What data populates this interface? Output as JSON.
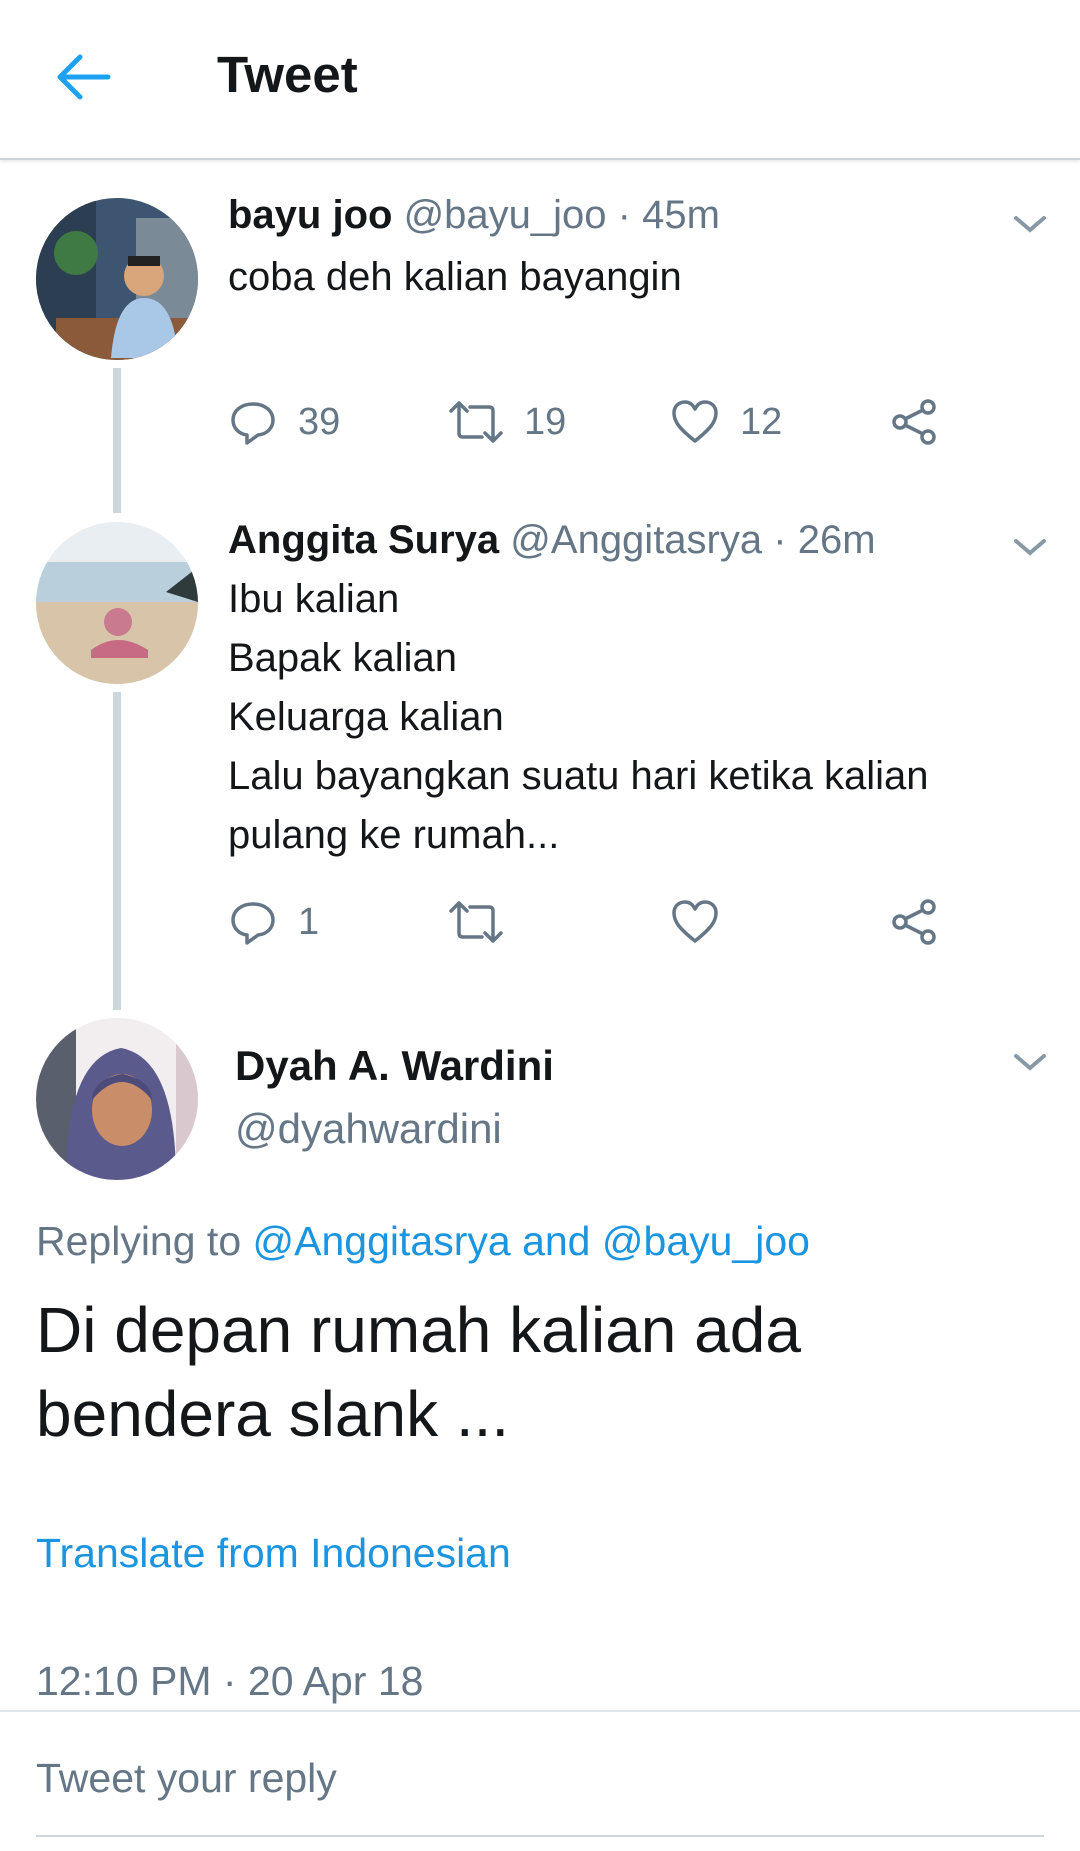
{
  "header": {
    "title": "Tweet",
    "back_icon": "arrow-left-icon",
    "accent": "#1da1f2"
  },
  "thread": [
    {
      "name": "bayu joo",
      "handle": "@bayu_joo",
      "separator": "·",
      "time": "45m",
      "text_lines": [
        "coba deh kalian bayangin"
      ],
      "actions": {
        "reply_count": "39",
        "retweet_count": "19",
        "like_count": "12"
      }
    },
    {
      "name": "Anggita Surya",
      "handle": "@Anggitasrya",
      "separator": "·",
      "time": "26m",
      "text_lines": [
        "Ibu kalian",
        "Bapak kalian",
        "Keluarga kalian",
        "Lalu bayangkan suatu hari ketika kalian",
        "pulang ke rumah..."
      ],
      "actions": {
        "reply_count": "1",
        "retweet_count": "",
        "like_count": ""
      }
    }
  ],
  "main_tweet": {
    "name": "Dyah A. Wardini",
    "handle": "@dyahwardini",
    "replying_prefix": "Replying to",
    "replying_user1": "@Anggitasrya",
    "replying_and": "and",
    "replying_user2": "@bayu_joo",
    "text_lines": [
      "Di depan rumah kalian ada",
      "bendera slank ..."
    ],
    "translate": "Translate from Indonesian",
    "timestamp": "12:10 PM · 20 Apr 18"
  },
  "reply_box": {
    "placeholder": "Tweet your reply"
  },
  "colors": {
    "link": "#1b95e0",
    "secondary_text": "#657786",
    "icon": "#657786"
  }
}
